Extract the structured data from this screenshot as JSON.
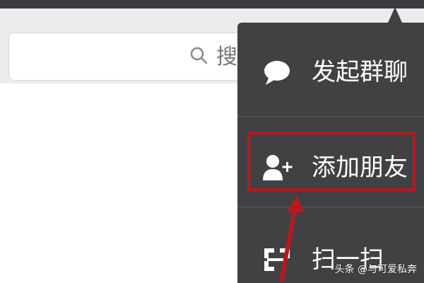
{
  "search": {
    "placeholder_visible": "搜索"
  },
  "menu": {
    "items": [
      {
        "label": "发起群聊",
        "icon": "chat-bubble-icon"
      },
      {
        "label": "添加朋友",
        "icon": "add-friend-icon"
      },
      {
        "label": "扫一扫",
        "icon": "scan-icon"
      }
    ]
  },
  "colors": {
    "menu_background": "#414144",
    "highlight": "#b8191d"
  },
  "watermark": {
    "text": "头条 @与可爱私奔"
  }
}
